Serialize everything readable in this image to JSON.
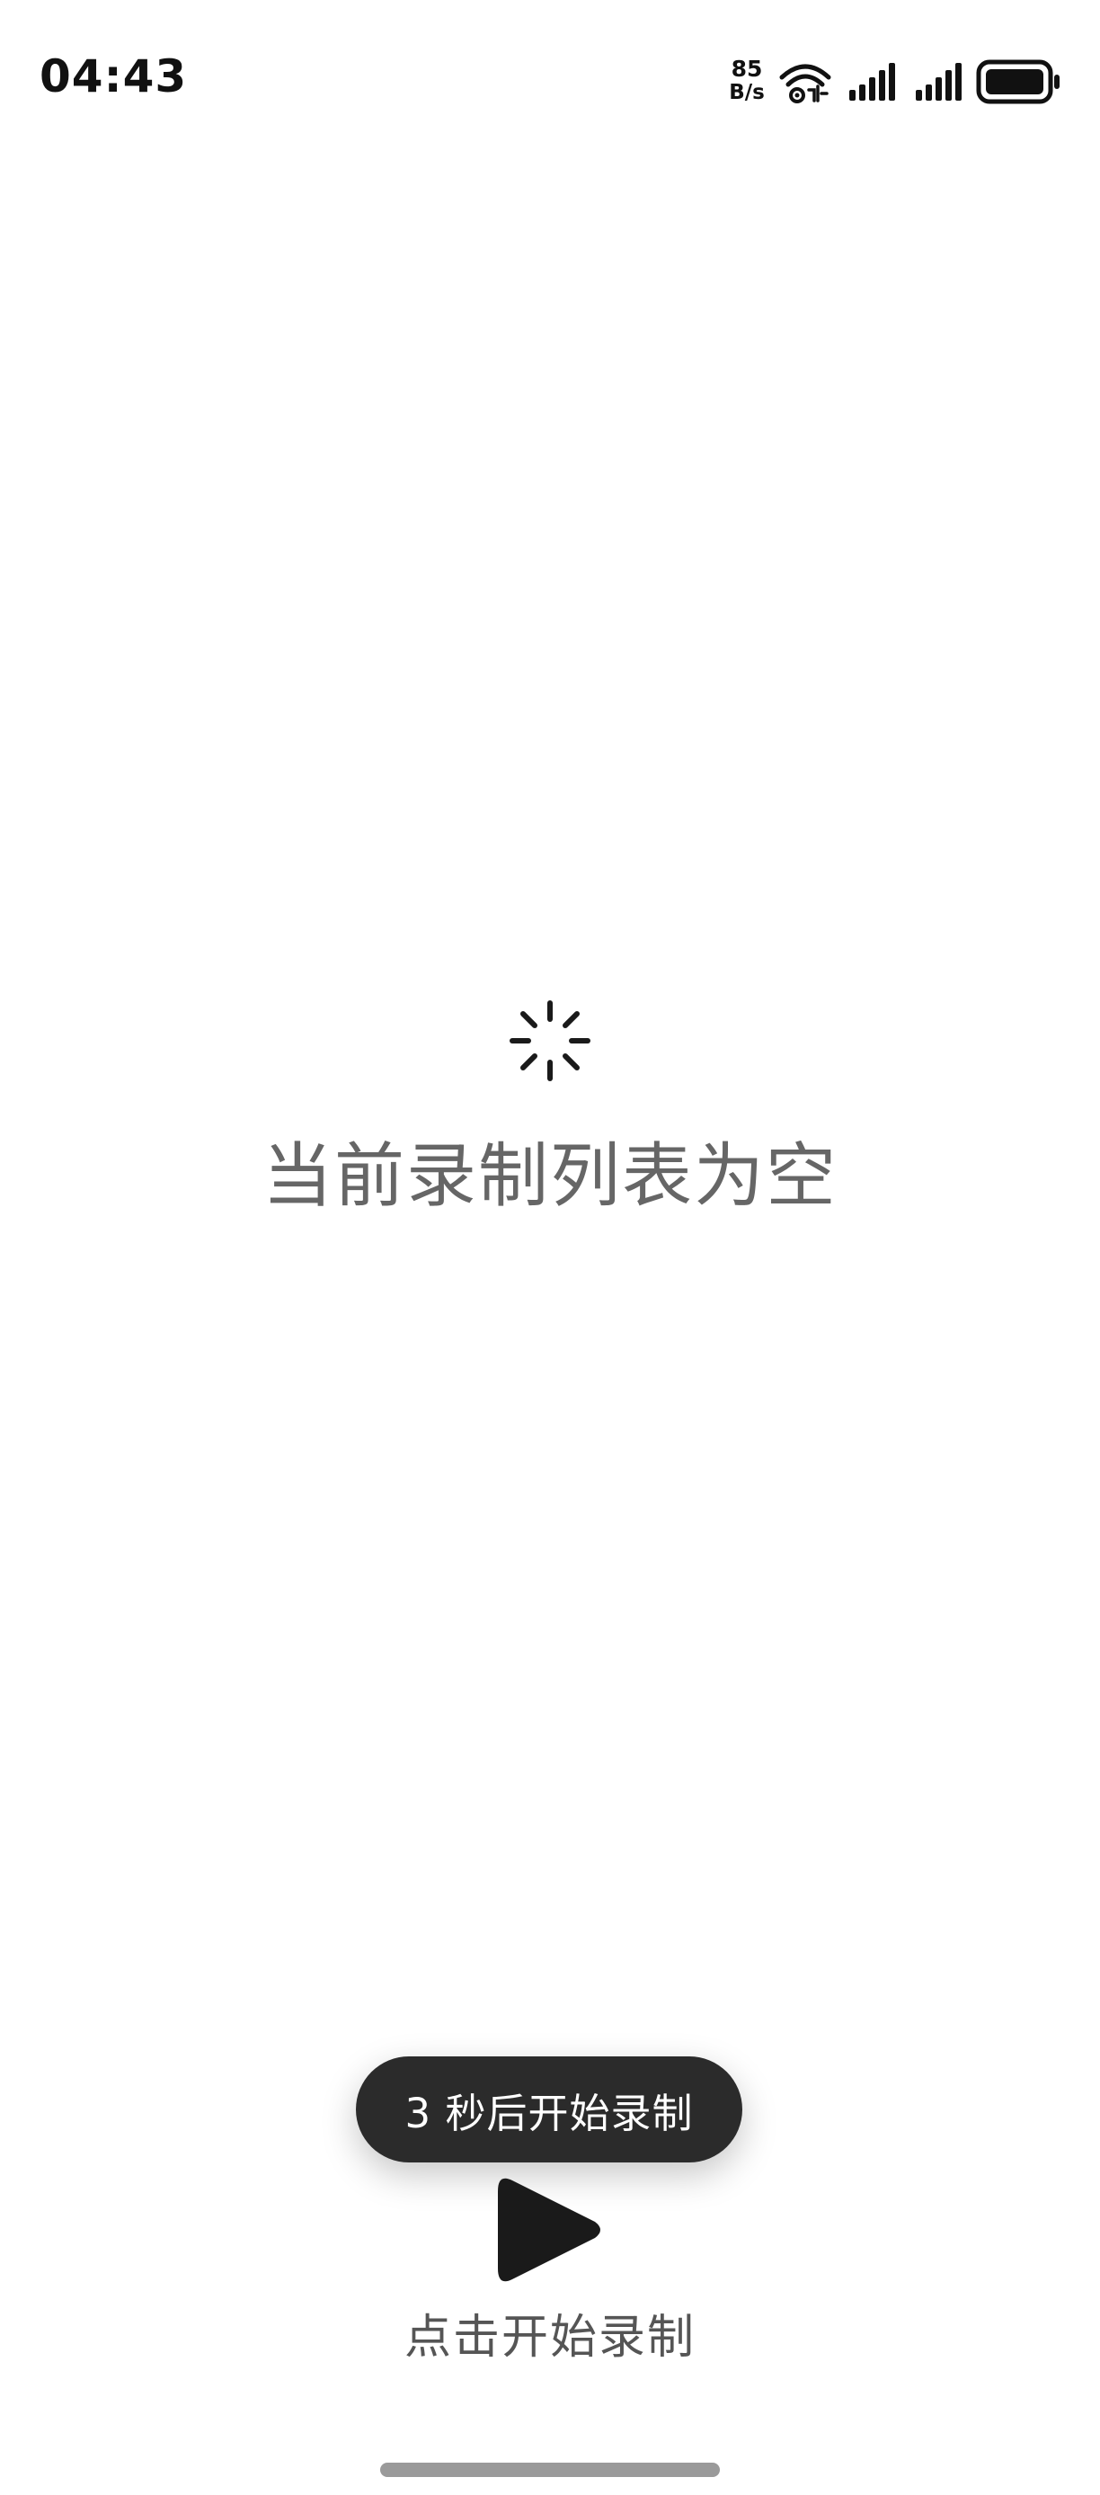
{
  "status_bar": {
    "time": "04:43",
    "net_speed_value": "85",
    "net_speed_unit": "B/s",
    "icons": [
      "wifi-icon",
      "signal-icon",
      "signal-icon",
      "battery-icon"
    ]
  },
  "empty_state": {
    "icon": "loading-spinner-icon",
    "message": "当前录制列表为空"
  },
  "toast": {
    "message": "3 秒后开始录制"
  },
  "record_control": {
    "icon": "play-icon",
    "label": "点击开始录制"
  },
  "colors": {
    "background": "#ffffff",
    "toast_bg": "#2b2b2b",
    "empty_text": "#666666",
    "play_icon": "#1a1a1a"
  }
}
